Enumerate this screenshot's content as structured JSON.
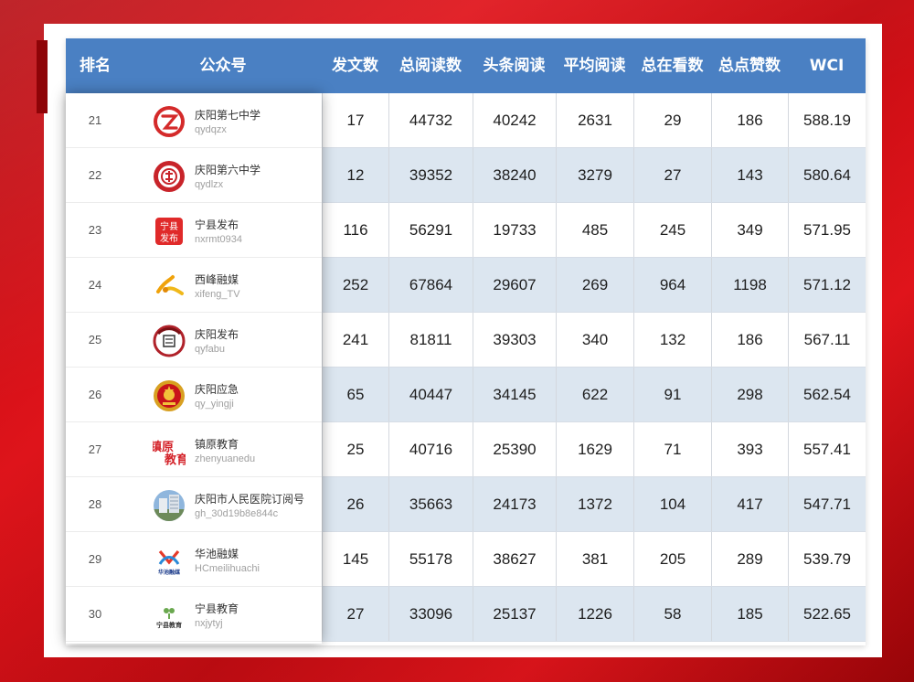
{
  "headers": {
    "rank": "排名",
    "account": "公众号",
    "posts": "发文数",
    "total_reads": "总阅读数",
    "headline_reads": "头条阅读",
    "avg_reads": "平均阅读",
    "total_looking": "总在看数",
    "total_likes": "总点赞数",
    "wci": "WCI"
  },
  "rows": [
    {
      "rank": "21",
      "name": "庆阳第七中学",
      "id": "qydqzx",
      "posts": "17",
      "total_reads": "44732",
      "headline_reads": "40242",
      "avg_reads": "2631",
      "looking": "29",
      "likes": "186",
      "wci": "588.19"
    },
    {
      "rank": "22",
      "name": "庆阳第六中学",
      "id": "qydlzx",
      "posts": "12",
      "total_reads": "39352",
      "headline_reads": "38240",
      "avg_reads": "3279",
      "looking": "27",
      "likes": "143",
      "wci": "580.64"
    },
    {
      "rank": "23",
      "name": "宁县发布",
      "id": "nxrmt0934",
      "posts": "116",
      "total_reads": "56291",
      "headline_reads": "19733",
      "avg_reads": "485",
      "looking": "245",
      "likes": "349",
      "wci": "571.95"
    },
    {
      "rank": "24",
      "name": "西峰融媒",
      "id": "xifeng_TV",
      "posts": "252",
      "total_reads": "67864",
      "headline_reads": "29607",
      "avg_reads": "269",
      "looking": "964",
      "likes": "1198",
      "wci": "571.12"
    },
    {
      "rank": "25",
      "name": "庆阳发布",
      "id": "qyfabu",
      "posts": "241",
      "total_reads": "81811",
      "headline_reads": "39303",
      "avg_reads": "340",
      "looking": "132",
      "likes": "186",
      "wci": "567.11"
    },
    {
      "rank": "26",
      "name": "庆阳应急",
      "id": "qy_yingji",
      "posts": "65",
      "total_reads": "40447",
      "headline_reads": "34145",
      "avg_reads": "622",
      "looking": "91",
      "likes": "298",
      "wci": "562.54"
    },
    {
      "rank": "27",
      "name": "镇原教育",
      "id": "zhenyuanedu",
      "posts": "25",
      "total_reads": "40716",
      "headline_reads": "25390",
      "avg_reads": "1629",
      "looking": "71",
      "likes": "393",
      "wci": "557.41"
    },
    {
      "rank": "28",
      "name": "庆阳市人民医院订阅号",
      "id": "gh_30d19b8e844c",
      "posts": "26",
      "total_reads": "35663",
      "headline_reads": "24173",
      "avg_reads": "1372",
      "looking": "104",
      "likes": "417",
      "wci": "547.71"
    },
    {
      "rank": "29",
      "name": "华池融媒",
      "id": "HCmeilihuachi",
      "posts": "145",
      "total_reads": "55178",
      "headline_reads": "38627",
      "avg_reads": "381",
      "looking": "205",
      "likes": "289",
      "wci": "539.79"
    },
    {
      "rank": "30",
      "name": "宁县教育",
      "id": "nxjytyj",
      "posts": "27",
      "total_reads": "33096",
      "headline_reads": "25137",
      "avg_reads": "1226",
      "looking": "58",
      "likes": "185",
      "wci": "522.65"
    }
  ],
  "logos": {
    "ningxian_fabu_1": "宁县",
    "ningxian_fabu_2": "发布",
    "zhenyuan_1": "镇原",
    "zhenyuan_2": "教育",
    "huachi": "华池融媒",
    "ningxian_edu": "宁县教育"
  },
  "colors": {
    "header_bg": "#4a80c3",
    "row_alt_bg": "#dce6f0",
    "frame_red": "#d8111a"
  }
}
